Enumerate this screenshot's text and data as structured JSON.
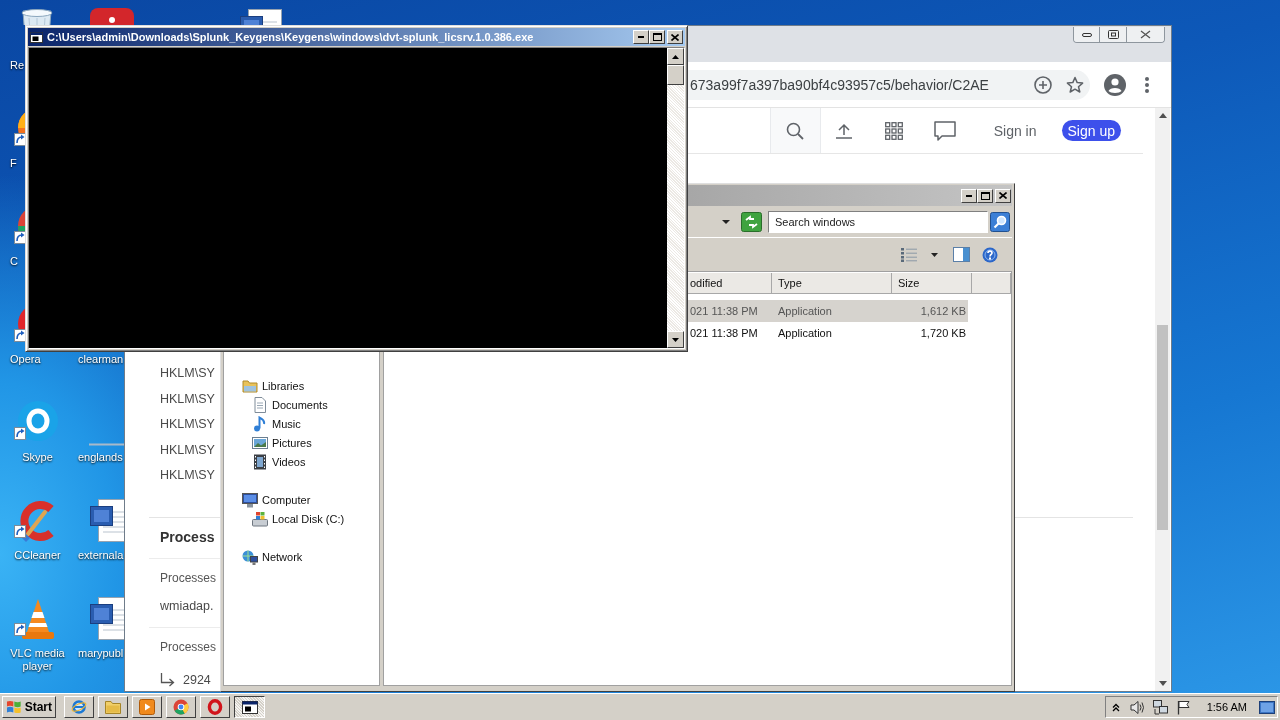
{
  "desktop": {
    "columns": [
      {
        "icons": [
          {
            "kind": "recycle-bin",
            "label": "Re"
          },
          {
            "kind": "firefox",
            "label": "F"
          },
          {
            "kind": "chrome",
            "label": "C"
          },
          {
            "kind": "opera",
            "label": "Opera"
          },
          {
            "kind": "skype",
            "label": "Skype"
          },
          {
            "kind": "ccleaner",
            "label": "CCleaner"
          },
          {
            "kind": "vlc",
            "label": "VLC media player"
          }
        ]
      },
      {
        "icons": [
          {
            "kind": "app-tile"
          },
          {
            "label": "clearman"
          },
          {
            "kind": "file",
            "label": "englands"
          },
          {
            "kind": "word",
            "label": "externala"
          },
          {
            "kind": "word",
            "label": "marypubl"
          }
        ]
      },
      {
        "icons": [
          {
            "kind": "word"
          }
        ]
      }
    ]
  },
  "browser": {
    "address": "673a99f7a397ba90bf4c93957c5/behavior/C2AE",
    "header": {
      "sign_in": "Sign in",
      "sign_up": "Sign up"
    },
    "page_items": [
      {
        "kind": "key",
        "text": "HKLM\\SY"
      },
      {
        "kind": "key",
        "text": "HKLM\\SY"
      },
      {
        "kind": "key",
        "text": "HKLM\\SY"
      },
      {
        "kind": "key",
        "text": "HKLM\\SY"
      },
      {
        "kind": "key",
        "text": "HKLM\\SY"
      },
      {
        "kind": "heading",
        "text": "Process"
      },
      {
        "kind": "subheading",
        "text": "Processes"
      },
      {
        "kind": "text",
        "text": "wmiadap."
      },
      {
        "kind": "subheading",
        "text": "Processes"
      },
      {
        "kind": "child",
        "text": "2924"
      }
    ]
  },
  "explorer": {
    "search": {
      "placeholder": "Search windows"
    },
    "navigation": [
      {
        "kind": "libraries",
        "label": "Libraries",
        "children": [
          {
            "kind": "documents",
            "label": "Documents"
          },
          {
            "kind": "music",
            "label": "Music"
          },
          {
            "kind": "pictures",
            "label": "Pictures"
          },
          {
            "kind": "videos",
            "label": "Videos"
          }
        ]
      },
      {
        "kind": "computer",
        "label": "Computer",
        "children": [
          {
            "kind": "disk",
            "label": "Local Disk (C:)"
          }
        ]
      },
      {
        "kind": "network",
        "label": "Network"
      }
    ],
    "columns": [
      "odified",
      "Type",
      "Size"
    ],
    "rows": [
      {
        "cells": [
          "021 11:38 PM",
          "Application",
          "1,612 KB"
        ],
        "selected": true
      },
      {
        "cells": [
          "021 11:38 PM",
          "Application",
          "1,720 KB"
        ],
        "selected": false
      }
    ]
  },
  "console": {
    "title": "C:\\Users\\admin\\Downloads\\Splunk_Keygens\\Keygens\\windows\\dvt-splunk_licsrv.1.0.386.exe"
  },
  "taskbar": {
    "start": "Start",
    "quick_launch": [
      {
        "kind": "ie"
      },
      {
        "kind": "folder"
      },
      {
        "kind": "media"
      },
      {
        "kind": "chrome"
      },
      {
        "kind": "opera"
      }
    ],
    "tasks": [
      {
        "kind": "console",
        "selected": true
      }
    ],
    "tray_icons": [
      {
        "kind": "chevron"
      },
      {
        "kind": "speaker"
      },
      {
        "kind": "network"
      },
      {
        "kind": "flag"
      }
    ],
    "clock": "1:56 AM"
  }
}
